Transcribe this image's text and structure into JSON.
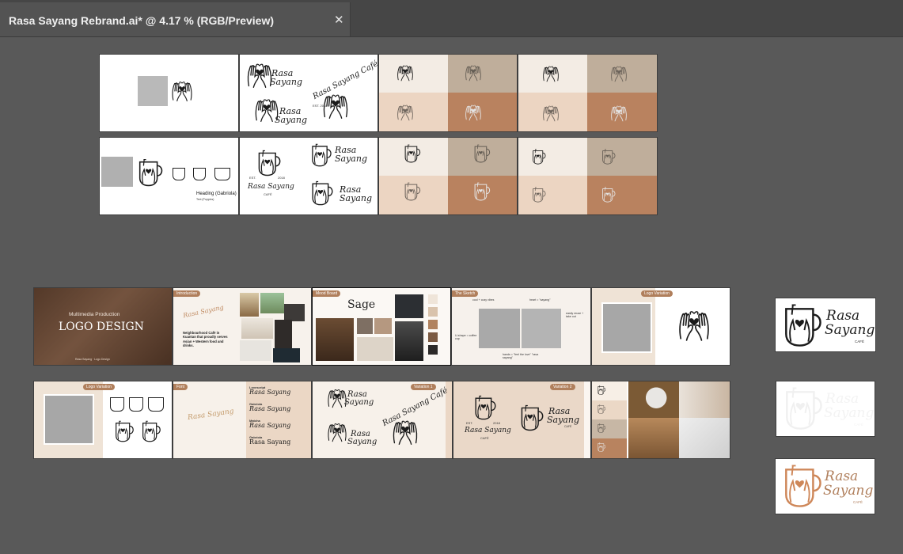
{
  "tab": {
    "title": "Rasa Sayang Rebrand.ai* @ 4.17 % (RGB/Preview)",
    "close_glyph": "✕"
  },
  "colors": {
    "canvas": "#595959",
    "tabbar": "#464646",
    "brand_brown": "#b07f5c",
    "brand_tan": "#bfae9b",
    "brand_cream": "#f1e6da",
    "brand_beige": "#ead3c0"
  },
  "logo": {
    "line1": "Rasa",
    "line2": "Sayang",
    "cafe": "CAFÉ",
    "arc": "Rasa Sayang Café",
    "est": "EST.",
    "year": "2018",
    "est_year": "EST. 2018"
  },
  "sketch_note": {
    "title": "Heading (Gabriola)",
    "sub": "Text (Poppins)"
  },
  "slides": {
    "cover_sub": "Multimedia Production",
    "cover_title": "LOGO DESIGN",
    "cover_foot": "Rasa Sayang · Logo Design",
    "intro_label": "Introduction",
    "intro_text": "Neighbourhood Café in Kuantan that proudly serves Asian + Western food and drinks.",
    "mood_label": "Mood Board",
    "mood_word": "Sage",
    "sketch_label": "The Sketch",
    "sketch_n1": "cool + cozy vibes",
    "sketch_n2": "heart = \"sayang\"",
    "sketch_n3": "U-shape = coffee cup",
    "sketch_n4": "hands = \"feel the love\" \"rasa sayang\"",
    "sketch_n5": "easily reuse + take out",
    "logo_var_label": "Logo Variation",
    "font_label": "Font",
    "font_names": [
      "Lovescript",
      "Gabriola",
      "Matcha",
      "Gabriola"
    ],
    "variation1_label": "Variation 1",
    "variation2_label": "Variation 2"
  }
}
